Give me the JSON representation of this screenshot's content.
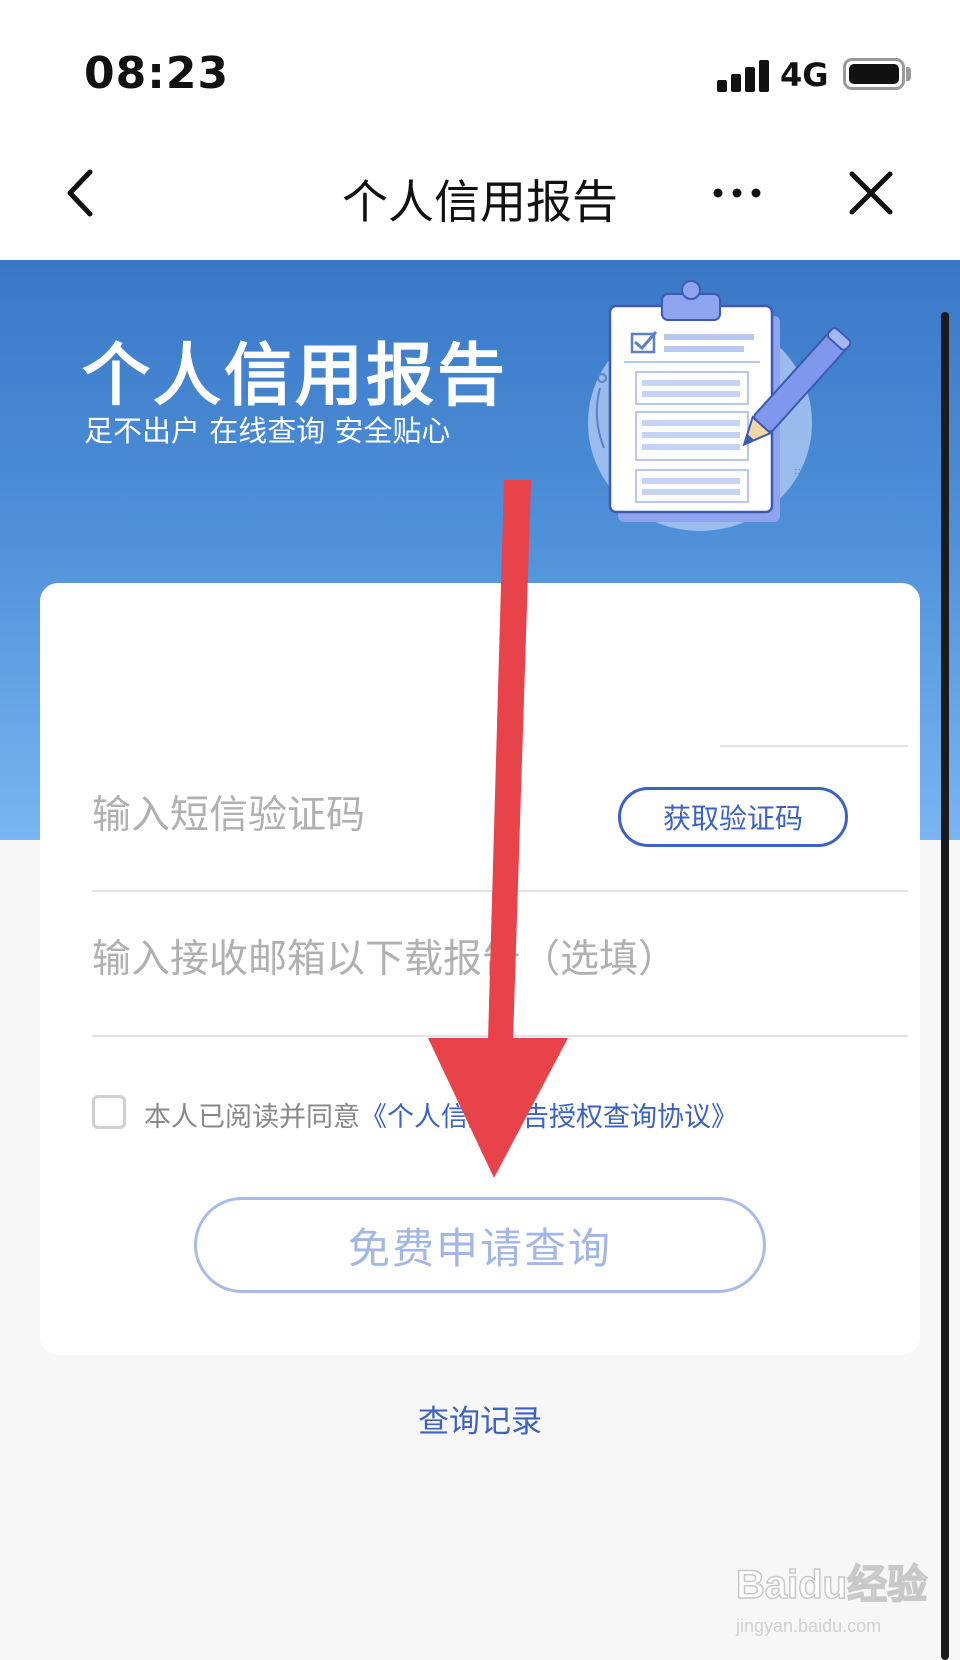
{
  "status_bar": {
    "time": "08:23",
    "network": "4G"
  },
  "nav": {
    "title": "个人信用报告"
  },
  "hero": {
    "title": "个人信用报告",
    "subtitle": "足不出户 在线查询 安全贴心"
  },
  "form": {
    "sms_code_placeholder": "输入短信验证码",
    "get_code_label": "获取验证码",
    "email_placeholder": "输入接收邮箱以下载报告（选填）",
    "agreement_prefix": "本人已阅读并同意",
    "agreement_link": "《个人信用报告授权查询协议》",
    "submit_label": "免费申请查询"
  },
  "footer": {
    "history_link": "查询记录"
  },
  "watermark": {
    "logo": "Baidu经验",
    "url": "jingyan.baidu.com"
  },
  "colors": {
    "accent": "#3b62c4",
    "hero_top": "#3a78c6",
    "hero_bottom": "#79b5f2",
    "annotation_arrow": "#e8434b"
  }
}
